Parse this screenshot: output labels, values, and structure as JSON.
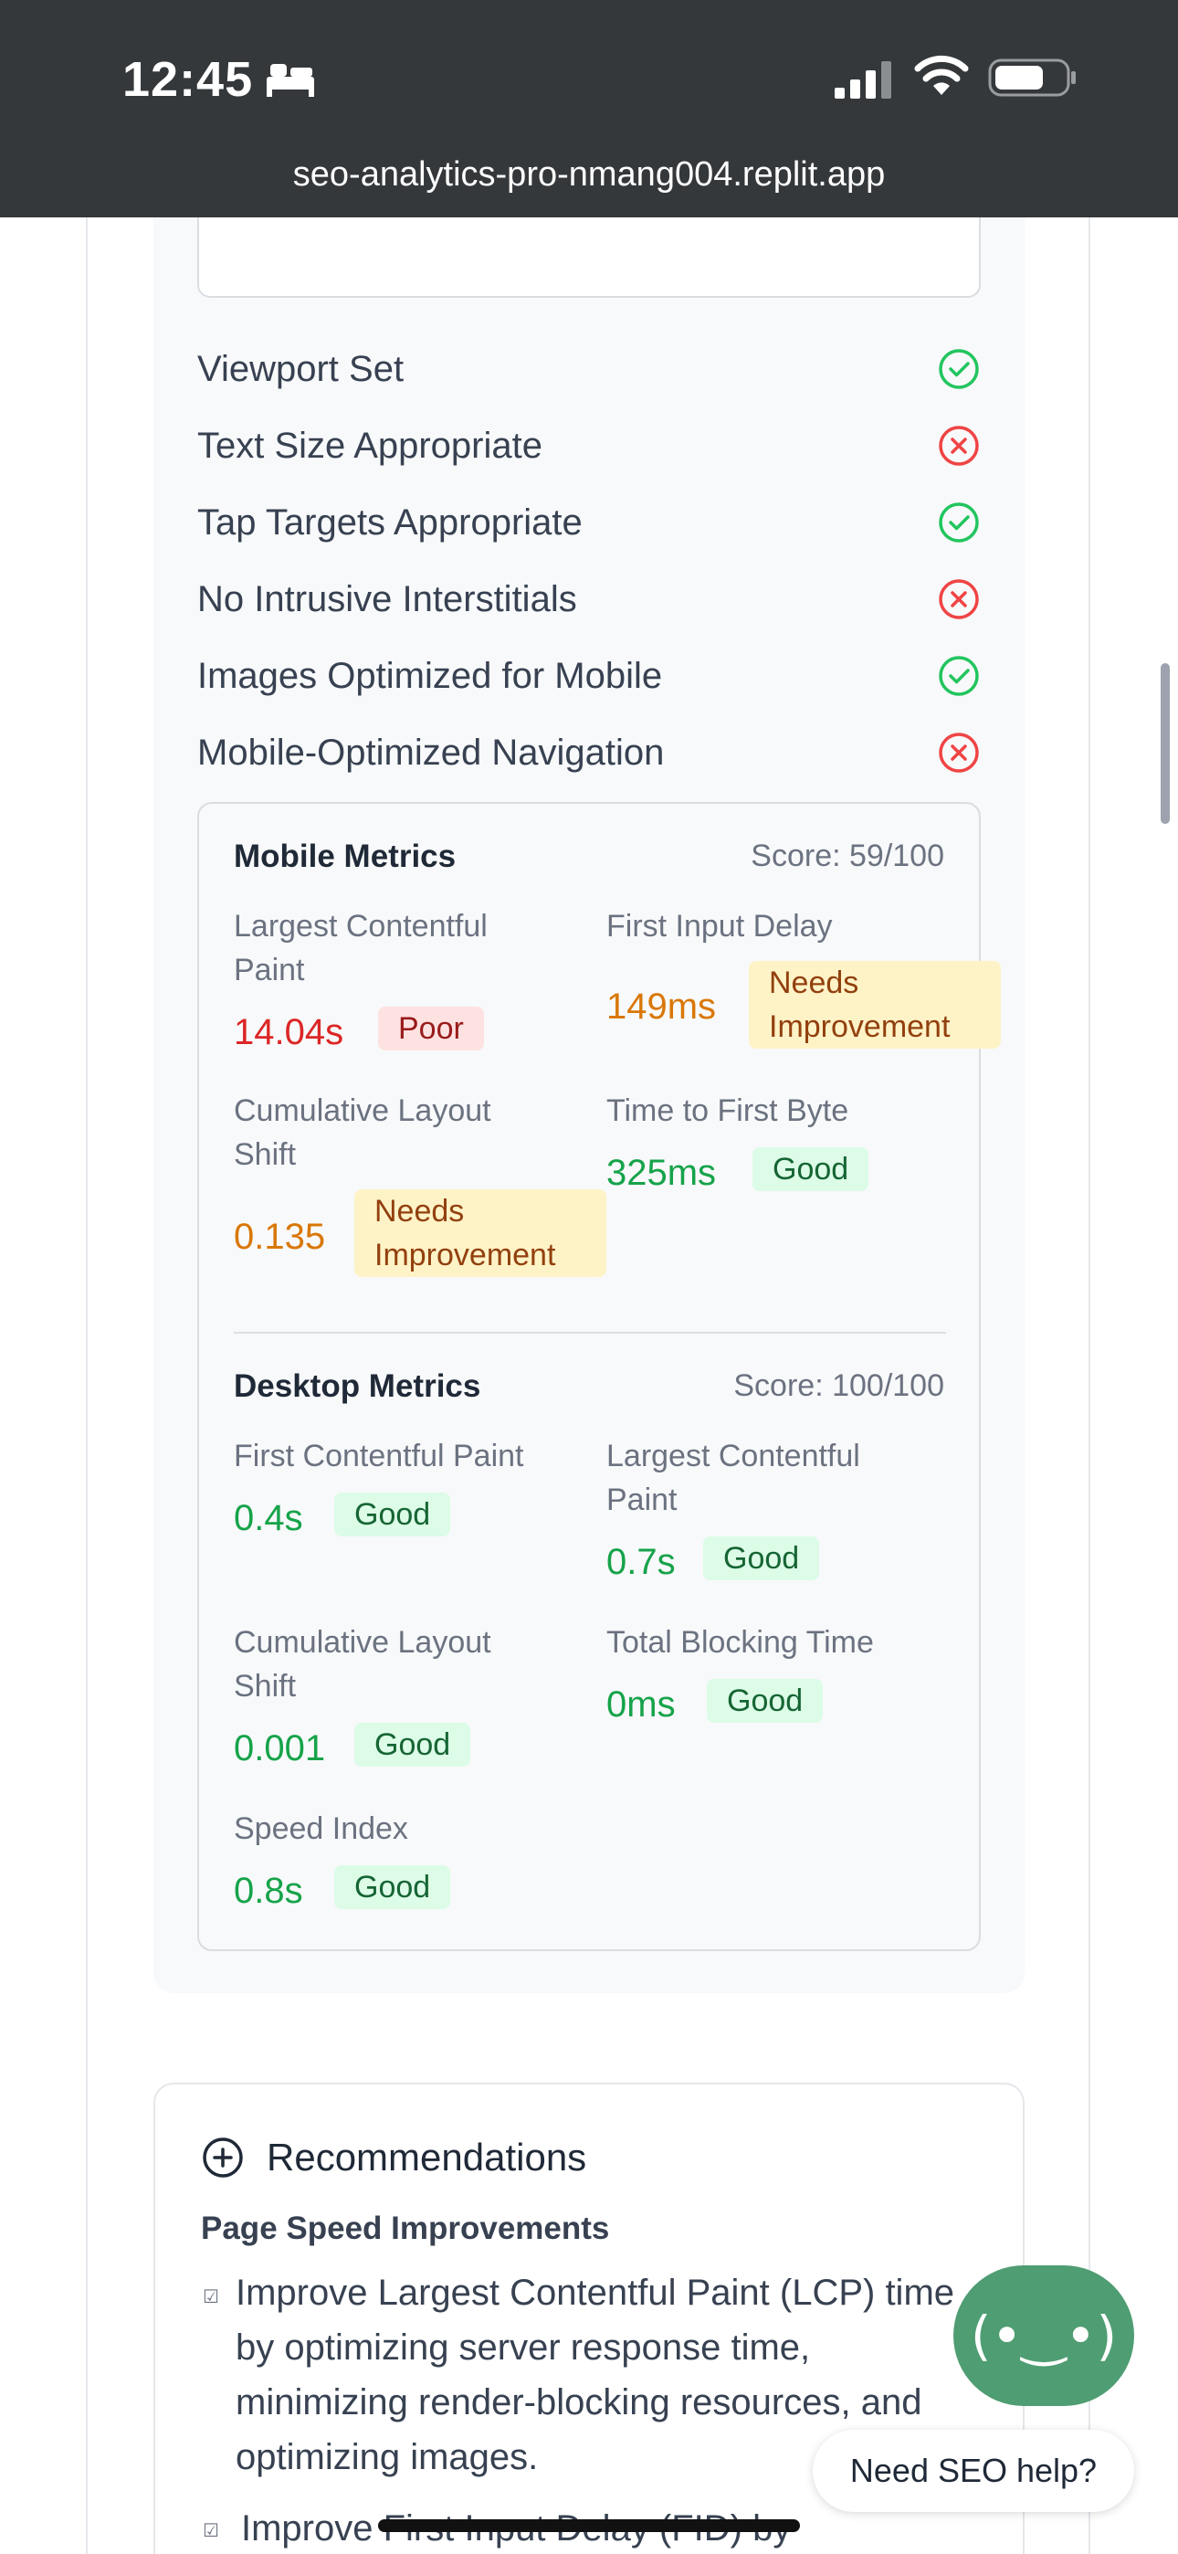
{
  "status_bar": {
    "time": "12:45",
    "url": "seo-analytics-pro-nmang004.replit.app"
  },
  "checklist": [
    {
      "label": "Viewport Set",
      "status": "pass"
    },
    {
      "label": "Text Size Appropriate",
      "status": "fail"
    },
    {
      "label": "Tap Targets Appropriate",
      "status": "pass"
    },
    {
      "label": "No Intrusive Interstitials",
      "status": "fail"
    },
    {
      "label": "Images Optimized for Mobile",
      "status": "pass"
    },
    {
      "label": "Mobile-Optimized Navigation",
      "status": "fail"
    }
  ],
  "mobile_metrics": {
    "title": "Mobile Metrics",
    "score": "Score: 59/100",
    "items": [
      {
        "label": "Largest Contentful Paint",
        "value": "14.04s",
        "rating": "Poor"
      },
      {
        "label": "First Input Delay",
        "value": "149ms",
        "rating": "Needs Improvement"
      },
      {
        "label": "Cumulative Layout Shift",
        "value": "0.135",
        "rating": "Needs Improvement"
      },
      {
        "label": "Time to First Byte",
        "value": "325ms",
        "rating": "Good"
      }
    ]
  },
  "desktop_metrics": {
    "title": "Desktop Metrics",
    "score": "Score: 100/100",
    "items": [
      {
        "label": "First Contentful Paint",
        "value": "0.4s",
        "rating": "Good"
      },
      {
        "label": "Largest Contentful Paint",
        "value": "0.7s",
        "rating": "Good"
      },
      {
        "label": "Cumulative Layout Shift",
        "value": "0.001",
        "rating": "Good"
      },
      {
        "label": "Total Blocking Time",
        "value": "0ms",
        "rating": "Good"
      },
      {
        "label": "Speed Index",
        "value": "0.8s",
        "rating": "Good"
      }
    ]
  },
  "recommendations": {
    "title": "Recommendations",
    "subtitle": "Page Speed Improvements",
    "items": [
      "Improve Largest Contentful Paint (LCP) time by optimizing server response time, minimizing render-blocking resources, and optimizing images.",
      "Improve First Input Delay (FID) by"
    ]
  },
  "help": {
    "bot_face": "(•‿•)",
    "bubble": "Need SEO help?"
  },
  "colors": {
    "pass": "#22c55e",
    "fail": "#ef4444",
    "good": "#16a34a",
    "poor": "#dc2626",
    "warn": "#d97706",
    "bot": "#4f9d73"
  },
  "icons": {
    "pass": "check-circle-icon",
    "fail": "x-circle-icon",
    "recommendations": "plus-circle-icon"
  }
}
